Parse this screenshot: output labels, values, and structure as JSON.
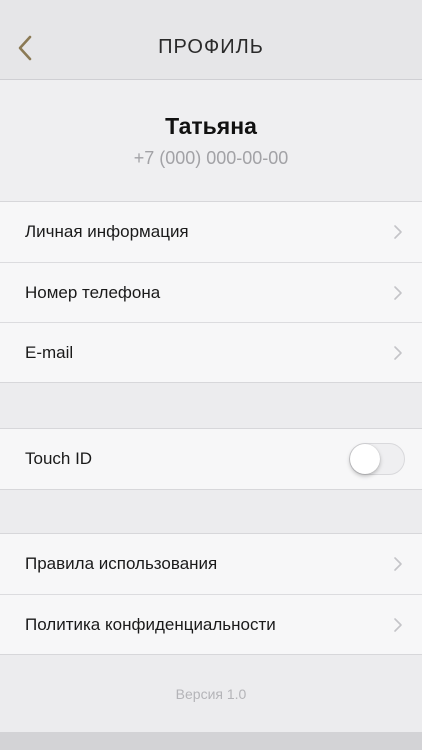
{
  "header": {
    "title": "ПРОФИЛЬ",
    "back_icon": "chevron-left-icon",
    "accent_color": "#8b7a55"
  },
  "profile": {
    "name": "Татьяна",
    "phone": "+7 (000) 000-00-00"
  },
  "personal_section": {
    "items": [
      {
        "label": "Личная информация"
      },
      {
        "label": "Номер телефона"
      },
      {
        "label": "E-mail"
      }
    ]
  },
  "security_section": {
    "touch_id_label": "Touch ID",
    "touch_id_enabled": false
  },
  "legal_section": {
    "items": [
      {
        "label": "Правила использования"
      },
      {
        "label": "Политика конфиденциальности"
      }
    ]
  },
  "footer": {
    "version": "Версия 1.0"
  }
}
